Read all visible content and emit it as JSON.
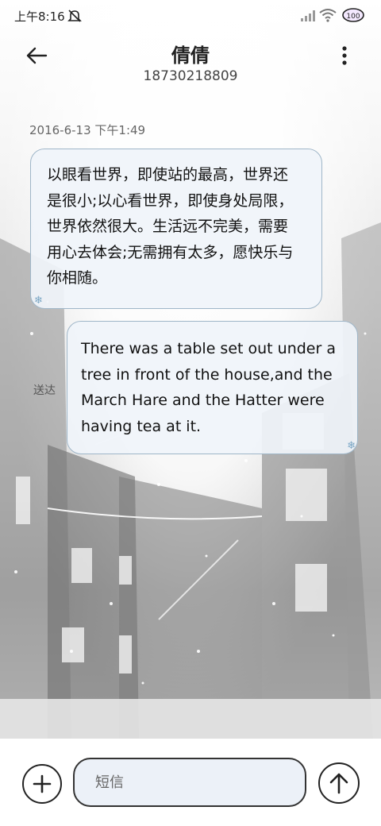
{
  "status_bar": {
    "time": "上午8:16",
    "icons": [
      "mute-icon",
      "signal-icon",
      "wifi-icon",
      "battery-icon"
    ]
  },
  "header": {
    "contact_name": "倩倩",
    "phone_number": "18730218809",
    "back_icon": "back-arrow-icon",
    "more_icon": "more-vertical-icon"
  },
  "conversation": {
    "timestamp": "2016-6-13 下午1:49",
    "messages": [
      {
        "direction": "incoming",
        "lines": [
          "以眼看世界，即使站的最高，世界还",
          "是很小;以心看世界，即使身处局限，",
          "世界依然很大。生活远不完美，需要",
          "用心去体会;无需拥有太多，愿快乐与",
          "你相随。"
        ]
      },
      {
        "direction": "outgoing",
        "lines": [
          "There was a table set out under a",
          "tree in front of the house,and the",
          "March Hare and the Hatter were",
          "having tea at it."
        ],
        "status": "送达"
      }
    ]
  },
  "input_bar": {
    "add_icon": "plus-icon",
    "placeholder": "短信",
    "value": "",
    "send_icon": "send-arrow-up-icon"
  },
  "colors": {
    "bubble_border": "#9fb6c8",
    "bubble_fill": "#f0f4fa",
    "input_fill": "#ecf1f8"
  }
}
